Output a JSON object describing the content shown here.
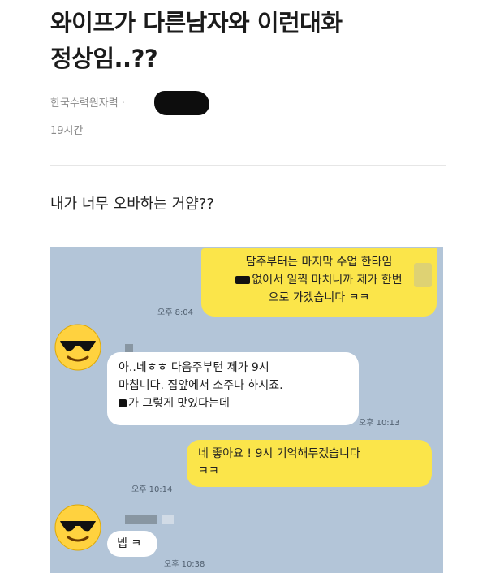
{
  "post": {
    "title_line1": "와이프가 다른남자와 이런대화",
    "title_line2": "정상임..??",
    "company": "한국수력원자력",
    "separator": "·",
    "time_ago": "19시간",
    "body": "내가 너무 오바하는 거얌??"
  },
  "chat": {
    "messages": [
      {
        "lines": [
          "담주부터는 마지막 수업 한타임",
          "없어서 일찍 마치니까 제가 한번",
          "으로 가겠습니다 ㅋㅋ"
        ],
        "time": "오후 8:04"
      },
      {
        "lines": [
          "아..네ㅎㅎ 다음주부턴 제가 9시",
          "마칩니다. 집앞에서 소주나 하시죠.",
          "가 그렇게 맛있다는데"
        ],
        "time": "오후 10:13"
      },
      {
        "lines": [
          "네 좋아요 ! 9시 기억해두겠습니다",
          "ㅋㅋ"
        ],
        "time": "오후 10:14"
      },
      {
        "lines": [
          "넵 ㅋ"
        ],
        "time": "오후 10:38"
      }
    ]
  },
  "colors": {
    "chat_background": "#b3c5d8",
    "outgoing_bubble": "#fbe54a",
    "incoming_bubble": "#ffffff"
  },
  "icons": {
    "avatar": "sunglasses-smiley-icon"
  }
}
